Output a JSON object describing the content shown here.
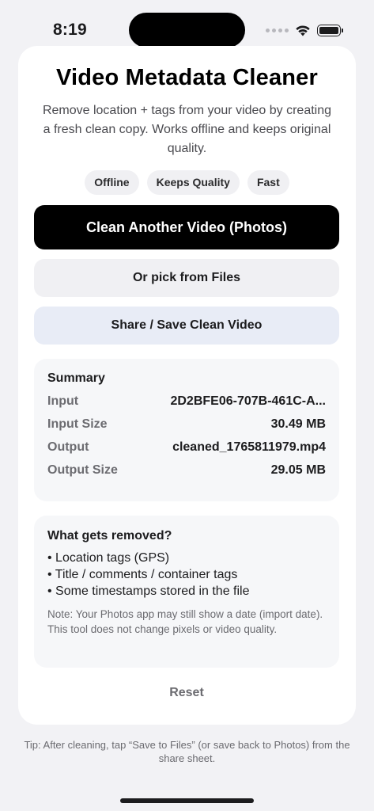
{
  "status": {
    "time": "8:19"
  },
  "app": {
    "title": "Video Metadata Cleaner",
    "subtitle": "Remove location + tags from your video by creating a fresh clean copy. Works offline and keeps original quality."
  },
  "chips": [
    "Offline",
    "Keeps Quality",
    "Fast"
  ],
  "buttons": {
    "primary": "Clean Another Video (Photos)",
    "files": "Or pick from Files",
    "share": "Share / Save Clean Video",
    "reset": "Reset"
  },
  "summary": {
    "title": "Summary",
    "rows": [
      {
        "label": "Input",
        "value": "2D2BFE06-707B-461C-A..."
      },
      {
        "label": "Input Size",
        "value": "30.49 MB"
      },
      {
        "label": "Output",
        "value": "cleaned_1765811979.mp4"
      },
      {
        "label": "Output Size",
        "value": "29.05 MB"
      }
    ]
  },
  "removed": {
    "title": "What gets removed?",
    "items": [
      "• Location tags (GPS)",
      "• Title / comments / container tags",
      "• Some timestamps stored in the file"
    ],
    "note": "Note: Your Photos app may still show a date (import date). This tool does not change pixels or video quality."
  },
  "tip": "Tip: After cleaning, tap “Save to Files” (or save back to Photos) from the share sheet.",
  "icons": {
    "wifi": "wifi-icon",
    "battery": "battery-icon",
    "signal": "signal-dots-icon"
  }
}
